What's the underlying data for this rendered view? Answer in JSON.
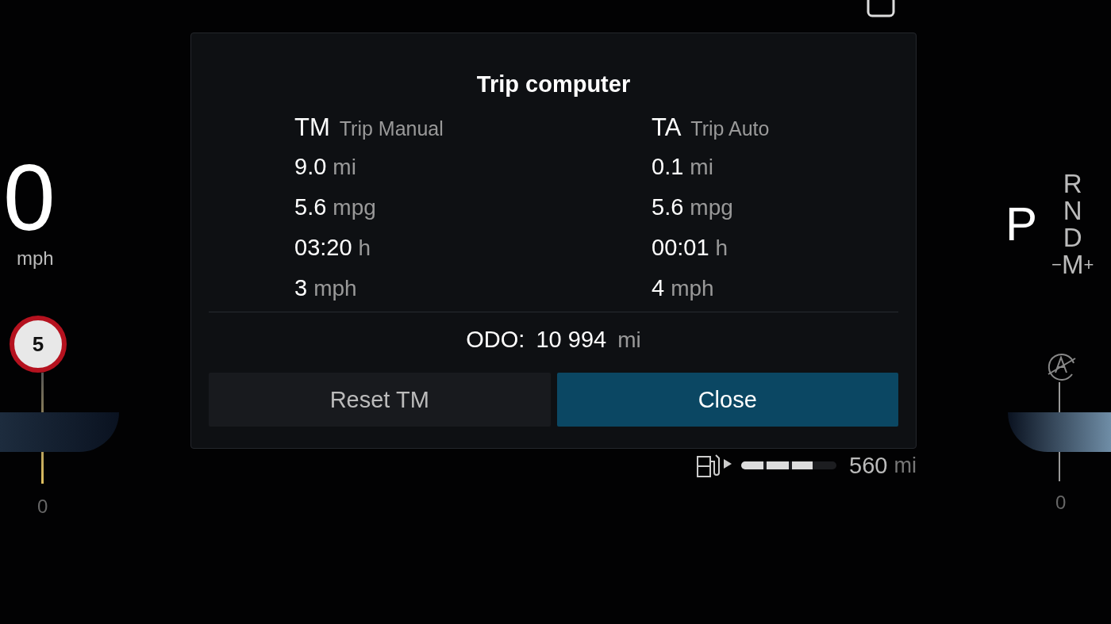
{
  "speedometer": {
    "speed": "0",
    "unit": "mph",
    "speed_limit": "5",
    "scale_min": "0"
  },
  "trip_computer": {
    "title": "Trip computer",
    "trips": [
      {
        "code": "TM",
        "name": "Trip Manual",
        "rows": [
          {
            "value": "9.0",
            "unit": "mi"
          },
          {
            "value": "5.6",
            "unit": "mpg"
          },
          {
            "value": "03:20",
            "unit": "h"
          },
          {
            "value": "3",
            "unit": "mph"
          }
        ]
      },
      {
        "code": "TA",
        "name": "Trip Auto",
        "rows": [
          {
            "value": "0.1",
            "unit": "mi"
          },
          {
            "value": "5.6",
            "unit": "mpg"
          },
          {
            "value": "00:01",
            "unit": "h"
          },
          {
            "value": "4",
            "unit": "mph"
          }
        ]
      }
    ],
    "odometer": {
      "label": "ODO:",
      "value": "10 994",
      "unit": "mi"
    },
    "buttons": [
      {
        "label": "Reset TM",
        "selected": false
      },
      {
        "label": "Close",
        "selected": true
      }
    ]
  },
  "fuel": {
    "level": 0.75,
    "range": "560",
    "unit": "mi"
  },
  "gear_selector": {
    "gears": [
      {
        "label": "P",
        "selected": true
      },
      {
        "label": "R",
        "selected": false
      },
      {
        "label": "N",
        "selected": false
      },
      {
        "label": "D",
        "selected": false
      }
    ],
    "manual_minus": "−",
    "manual": "M",
    "manual_plus": "+"
  },
  "tachometer": {
    "scale_min": "0"
  }
}
